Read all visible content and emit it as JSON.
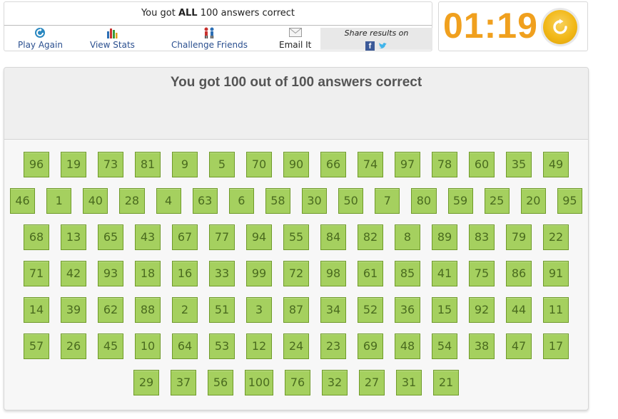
{
  "summary": {
    "prefix": "You got ",
    "emph": "ALL",
    "suffix": " 100 answers correct"
  },
  "actions": [
    {
      "label": "Play Again",
      "icon": "replay-icon"
    },
    {
      "label": "View Stats",
      "icon": "stats-icon"
    },
    {
      "label": "Challenge Friends",
      "icon": "people-icon"
    },
    {
      "label": "Email It",
      "icon": "envelope-icon"
    }
  ],
  "share": {
    "label": "Share results on",
    "networks": [
      "facebook-icon",
      "twitter-icon"
    ]
  },
  "timer": {
    "value": "01:19",
    "color": "#f0a01e"
  },
  "main": {
    "title": "You got 100 out of 100 answers correct"
  },
  "answers": {
    "rows": [
      [
        "96",
        "19",
        "73",
        "81",
        "9",
        "5",
        "70",
        "90",
        "66",
        "74",
        "97",
        "78",
        "60",
        "35",
        "49"
      ],
      [
        "46",
        "1",
        "40",
        "28",
        "4",
        "63",
        "6",
        "58",
        "30",
        "50",
        "7",
        "80",
        "59",
        "25",
        "20",
        "95"
      ],
      [
        "68",
        "13",
        "65",
        "43",
        "67",
        "77",
        "94",
        "55",
        "84",
        "82",
        "8",
        "89",
        "83",
        "79",
        "22"
      ],
      [
        "71",
        "42",
        "93",
        "18",
        "16",
        "33",
        "99",
        "72",
        "98",
        "61",
        "85",
        "41",
        "75",
        "86",
        "91"
      ],
      [
        "14",
        "39",
        "62",
        "88",
        "2",
        "51",
        "3",
        "87",
        "34",
        "52",
        "36",
        "15",
        "92",
        "44",
        "11"
      ],
      [
        "57",
        "26",
        "45",
        "10",
        "64",
        "53",
        "12",
        "24",
        "23",
        "69",
        "48",
        "54",
        "38",
        "47",
        "17"
      ],
      [
        "29",
        "37",
        "56",
        "100",
        "76",
        "32",
        "27",
        "31",
        "21"
      ]
    ],
    "tile_color": "#a5d05f"
  }
}
